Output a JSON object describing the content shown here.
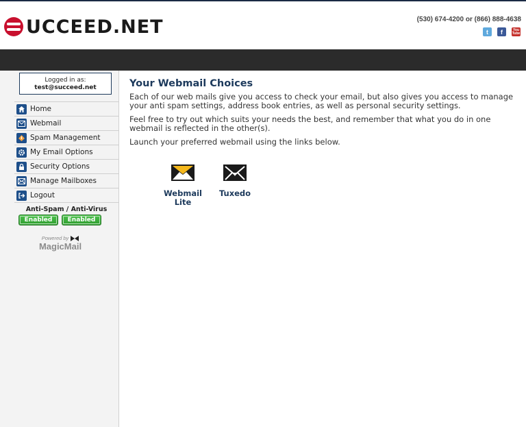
{
  "header": {
    "logo_text": "UCCEED.NET",
    "phone": "(530) 674-4200 or (866) 888-4638",
    "social": [
      "twitter-icon",
      "facebook-icon",
      "youtube-icon"
    ]
  },
  "sidebar": {
    "login_label": "Logged in as:",
    "login_user": "test@succeed.net",
    "menu": [
      {
        "label": "Home",
        "icon": "home-icon"
      },
      {
        "label": "Webmail",
        "icon": "envelope-icon"
      },
      {
        "label": "Spam Management",
        "icon": "spam-icon"
      },
      {
        "label": "My Email Options",
        "icon": "gear-icon"
      },
      {
        "label": "Security Options",
        "icon": "lock-icon"
      },
      {
        "label": "Manage Mailboxes",
        "icon": "mailbox-icon"
      },
      {
        "label": "Logout",
        "icon": "logout-icon"
      }
    ],
    "av_title": "Anti-Spam / Anti-Virus",
    "anti_spam_status": "Enabled",
    "anti_virus_status": "Enabled",
    "powered_by": "Powered by",
    "powered_brand": "MagicMail"
  },
  "main": {
    "title": "Your Webmail Choices",
    "para1": "Each of our web mails give you access to check your email, but also gives you access to manage your anti spam settings, address book entries, as well as personal security settings.",
    "para2": "Feel free to try out which suits your needs the best, and remember that what you do in one webmail is reflected in the other(s).",
    "para3": "Launch your preferred webmail using the links below.",
    "clients": [
      {
        "label": "Webmail Lite",
        "icon": "webmail-lite-icon"
      },
      {
        "label": "Tuxedo",
        "icon": "tuxedo-icon"
      }
    ]
  },
  "colors": {
    "brand_red": "#c8102e",
    "title_blue": "#1d3a5c",
    "nav_dark": "#2b2b2b",
    "status_green": "#3aaa3a"
  }
}
